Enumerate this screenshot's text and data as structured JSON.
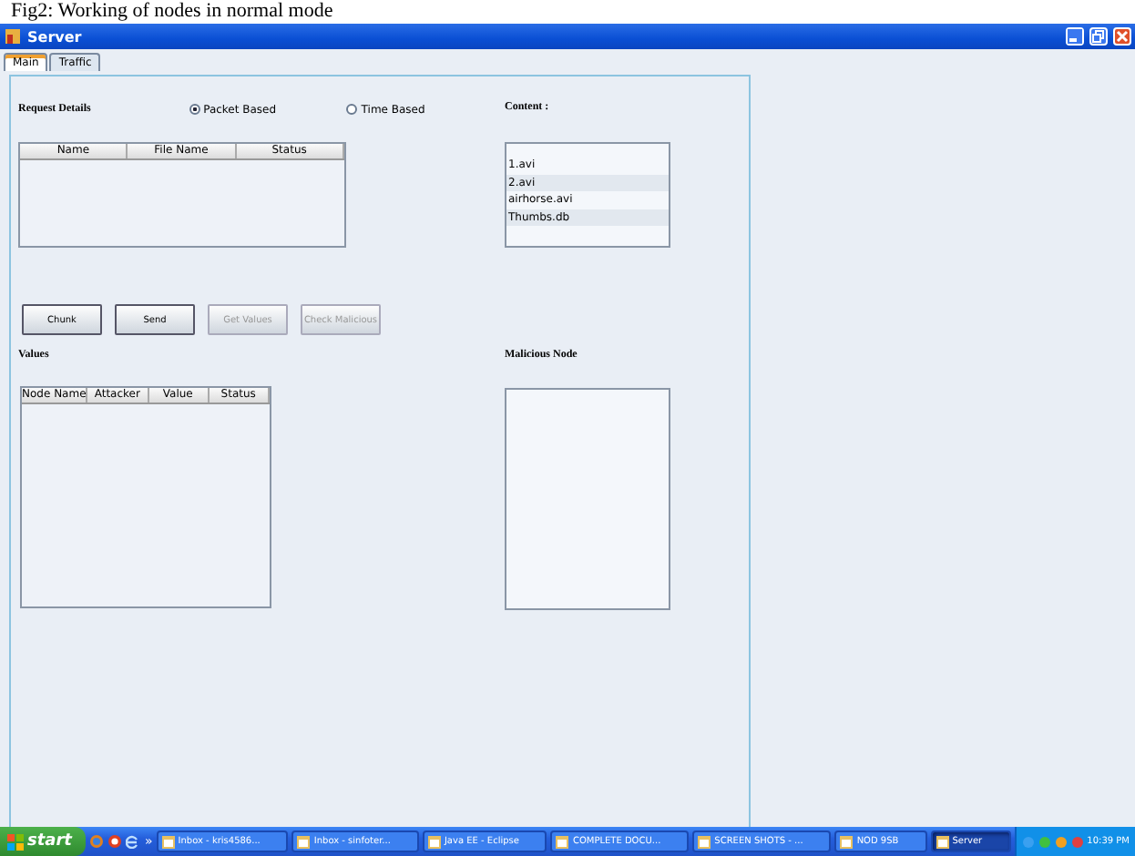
{
  "caption": "Fig2: Working of nodes in normal mode",
  "window": {
    "title": "Server"
  },
  "tabs": [
    {
      "label": "Main",
      "selected": true
    },
    {
      "label": "Traffic",
      "selected": false
    }
  ],
  "request_details": {
    "label": "Request Details",
    "modes": [
      {
        "label": "Packet Based",
        "selected": true
      },
      {
        "label": "Time Based",
        "selected": false
      }
    ],
    "table": {
      "columns": [
        "Name",
        "File Name",
        "Status"
      ]
    }
  },
  "content": {
    "label": "Content :",
    "items": [
      "1.avi",
      "2.avi",
      "airhorse.avi",
      "Thumbs.db"
    ]
  },
  "buttons": [
    {
      "label": "Chunk",
      "disabled": false
    },
    {
      "label": "Send",
      "disabled": false
    },
    {
      "label": "Get Values",
      "disabled": true
    },
    {
      "label": "Check Malicious",
      "disabled": true
    }
  ],
  "values": {
    "label": "Values",
    "table": {
      "columns": [
        "Node Name",
        "Attacker",
        "Value",
        "Status"
      ]
    }
  },
  "malicious_node": {
    "label": "Malicious Node"
  },
  "taskbar": {
    "start": "start",
    "more": "»",
    "tasks": [
      {
        "label": "Inbox - kris4586...",
        "selected": false
      },
      {
        "label": "Inbox - sinfoter...",
        "selected": false
      },
      {
        "label": "Java EE - Eclipse",
        "selected": false
      },
      {
        "label": "COMPLETE DOCU...",
        "selected": false
      },
      {
        "label": "SCREEN SHOTS - ...",
        "selected": false
      },
      {
        "label": "NOD 9SB",
        "selected": false
      },
      {
        "label": "Server",
        "selected": true
      }
    ],
    "clock": "10:39 PM"
  }
}
